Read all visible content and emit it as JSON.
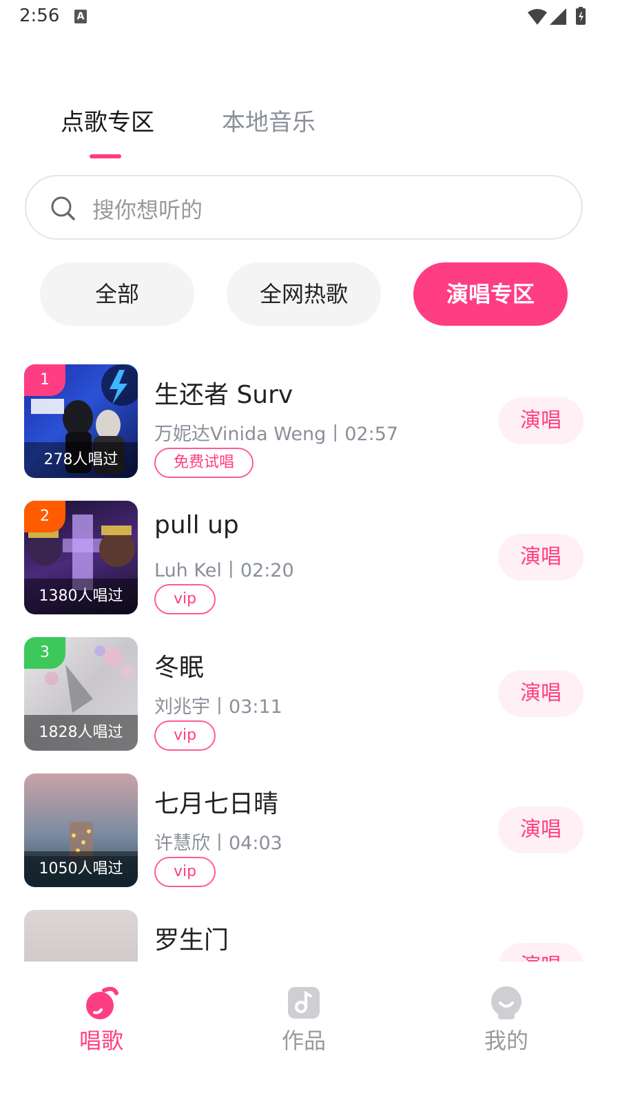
{
  "status_bar": {
    "time": "2:56",
    "notification_icon": "A"
  },
  "tabs": [
    {
      "label": "点歌专区",
      "active": true
    },
    {
      "label": "本地音乐",
      "active": false
    }
  ],
  "search": {
    "placeholder": "搜你想听的"
  },
  "filters": [
    {
      "label": "全部",
      "active": false
    },
    {
      "label": "全网热歌",
      "active": false
    },
    {
      "label": "演唱专区",
      "active": true
    }
  ],
  "songs": [
    {
      "rank": "1",
      "rank_color": "#ff3d82",
      "cover_count": "278人唱过",
      "title": "生还者 Surv",
      "meta": "万妮达Vinida Weng丨02:57",
      "tag": "免费试唱",
      "action": "演唱"
    },
    {
      "rank": "2",
      "rank_color": "#ff5b00",
      "cover_count": "1380人唱过",
      "title": "pull up",
      "meta": "Luh Kel丨02:20",
      "tag": "vip",
      "action": "演唱"
    },
    {
      "rank": "3",
      "rank_color": "#3cc85a",
      "cover_count": "1828人唱过",
      "title": "冬眠",
      "meta": "刘兆宇丨03:11",
      "tag": "vip",
      "action": "演唱"
    },
    {
      "rank": "",
      "rank_color": "",
      "cover_count": "1050人唱过",
      "title": "七月七日晴",
      "meta": "许慧欣丨04:03",
      "tag": "vip",
      "action": "演唱"
    },
    {
      "rank": "",
      "rank_color": "",
      "cover_count": "",
      "title": "罗生门",
      "meta": "",
      "tag": "",
      "action": "演唱"
    }
  ],
  "bottom_nav": [
    {
      "label": "唱歌",
      "icon": "music-note-icon",
      "active": true
    },
    {
      "label": "作品",
      "icon": "works-icon",
      "active": false
    },
    {
      "label": "我的",
      "icon": "profile-icon",
      "active": false
    }
  ],
  "colors": {
    "accent": "#ff3d82",
    "accent_light": "#fff0f5",
    "muted_text": "#8a8f99"
  }
}
